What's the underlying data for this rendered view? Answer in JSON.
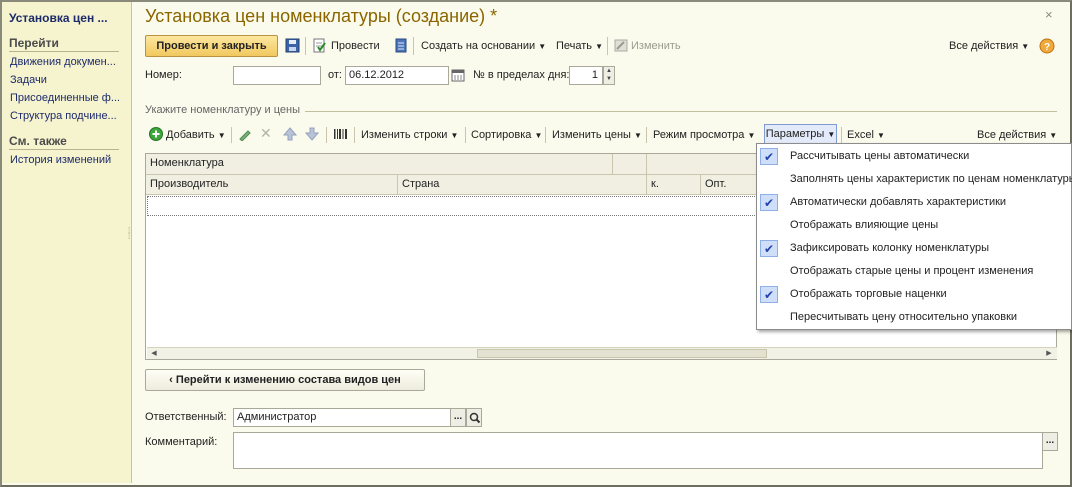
{
  "sidebar": {
    "title": "Установка цен ...",
    "goto_header": "Перейти",
    "goto_items": [
      "Движения докумен...",
      "Задачи",
      "Присоединенные ф...",
      "Структура подчине..."
    ],
    "see_also_header": "См. также",
    "see_also_items": [
      "История изменений"
    ]
  },
  "header": {
    "title": "Установка цен номенклатуры (создание) *"
  },
  "toolbar": {
    "post_and_close": "Провести и закрыть",
    "post": "Провести",
    "create_based": "Создать на основании",
    "print": "Печать",
    "edit": "Изменить",
    "all_actions": "Все действия"
  },
  "form": {
    "number_label": "Номер:",
    "number_value": "",
    "date_label": "от:",
    "date_value": "06.12.2012",
    "day_num_label": "№ в пределах дня:",
    "day_num_value": "1"
  },
  "section": {
    "title": "Укажите номенклатуру и цены"
  },
  "table_toolbar": {
    "add": "Добавить",
    "change_rows": "Изменить строки",
    "sort": "Сортировка",
    "change_prices": "Изменить цены",
    "view_mode": "Режим просмотра",
    "params": "Параметры",
    "excel": "Excel",
    "all_actions": "Все действия"
  },
  "table": {
    "header_row1": [
      "Номенклатура"
    ],
    "header_row2": [
      "Производитель",
      "Страна",
      "к.",
      "Опт."
    ]
  },
  "params_menu": {
    "items": [
      {
        "label": "Рассчитывать цены автоматически",
        "checked": true
      },
      {
        "label": "Заполнять цены характеристик по ценам номенклатуры",
        "checked": false
      },
      {
        "label": "Автоматически добавлять характеристики",
        "checked": true
      },
      {
        "label": "Отображать влияющие цены",
        "checked": false
      },
      {
        "label": "Зафиксировать колонку номенклатуры",
        "checked": true
      },
      {
        "label": "Отображать старые цены и процент изменения",
        "checked": false
      },
      {
        "label": "Отображать торговые наценки",
        "checked": true
      },
      {
        "label": "Пересчитывать цену относительно упаковки",
        "checked": false
      }
    ]
  },
  "back_button": "Перейти к изменению состава видов цен",
  "responsible": {
    "label": "Ответственный:",
    "value": "Администратор"
  },
  "comment": {
    "label": "Комментарий:",
    "value": ""
  },
  "colors": {
    "title": "#8a6500",
    "link": "#1d2b6b",
    "sidebar_bg": "#f6f3cf",
    "main_bg": "#fbfbed"
  }
}
